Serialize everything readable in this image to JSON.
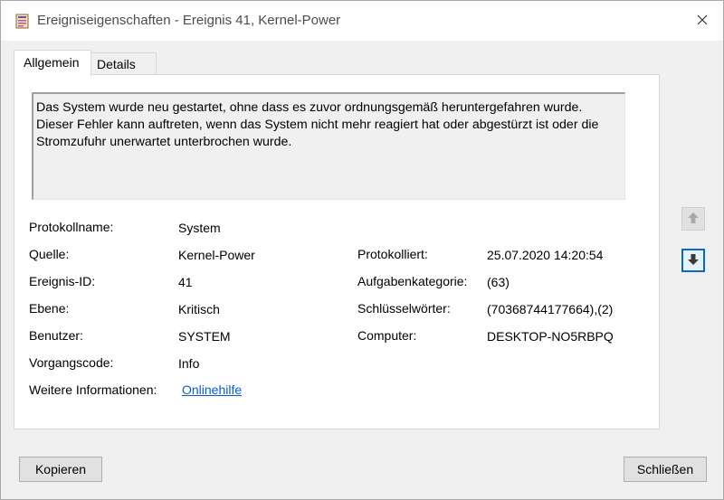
{
  "window": {
    "title": "Ereigniseigenschaften - Ereignis 41, Kernel-Power"
  },
  "tabs": [
    {
      "label": "Allgemein",
      "active": true
    },
    {
      "label": "Details",
      "active": false
    }
  ],
  "description": {
    "line1": "Das System wurde neu gestartet, ohne dass es zuvor ordnungsgemäß heruntergefahren wurde.",
    "line2": "Dieser Fehler kann auftreten, wenn das System nicht mehr reagiert hat oder abgestürzt ist oder die",
    "line3": "Stromzufuhr unerwartet unterbrochen wurde."
  },
  "fields": {
    "protokollname": {
      "label": "Protokollname:",
      "value": "System"
    },
    "quelle": {
      "label": "Quelle:",
      "value": "Kernel-Power"
    },
    "ereignis_id": {
      "label": "Ereignis-ID:",
      "value": "41"
    },
    "ebene": {
      "label": "Ebene:",
      "value": "Kritisch"
    },
    "benutzer": {
      "label": "Benutzer:",
      "value": "SYSTEM"
    },
    "vorgangscode": {
      "label": "Vorgangscode:",
      "value": "Info"
    },
    "weitere_informationen": {
      "label": "Weitere Informationen:",
      "link": "Onlinehilfe"
    },
    "protokolliert": {
      "label": "Protokolliert:",
      "value": "25.07.2020 14:20:54"
    },
    "aufgabenkategorie": {
      "label": "Aufgabenkategorie:",
      "value": "(63)"
    },
    "schluesselwoerter": {
      "label": "Schlüsselwörter:",
      "value": "(70368744177664),(2)"
    },
    "computer": {
      "label": "Computer:",
      "value": "DESKTOP-NO5RBPQ"
    }
  },
  "buttons": {
    "copy": "Kopieren",
    "close": "Schließen"
  },
  "icons": {
    "app": "event-viewer-icon",
    "close": "close-icon",
    "previous": "arrow-up-icon",
    "next": "arrow-down-icon"
  },
  "colors": {
    "link": "#0b5bd7",
    "focus_border": "#0a66c8"
  }
}
